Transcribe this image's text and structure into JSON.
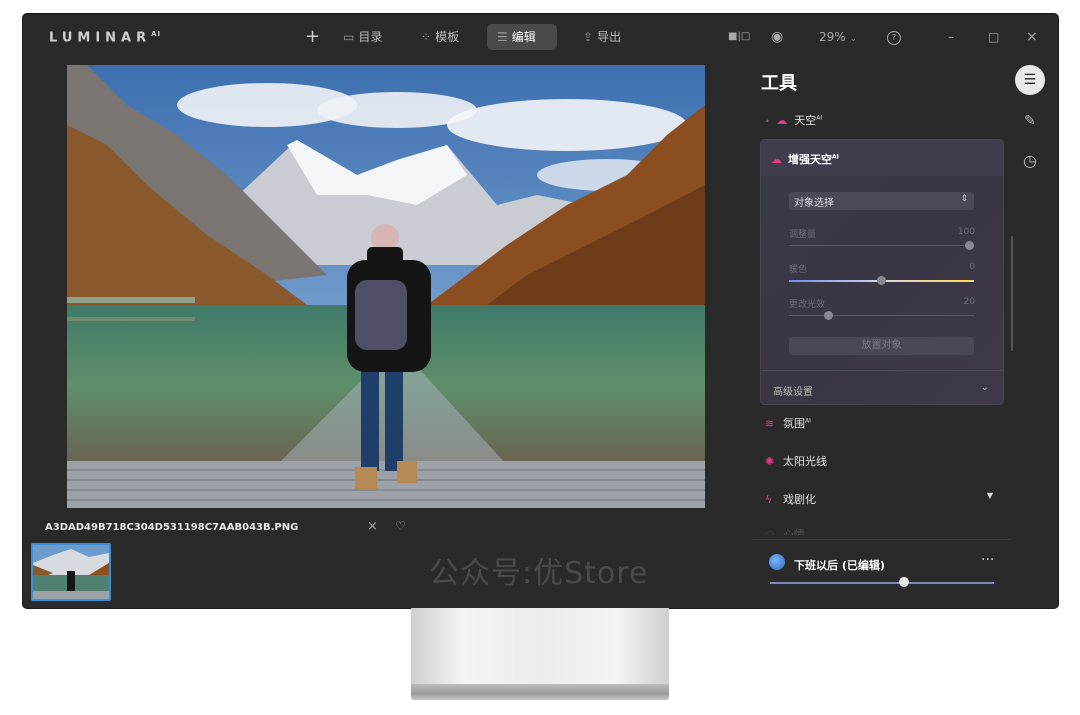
{
  "app": {
    "logo": "LUMINAR",
    "logo_sup": "AI"
  },
  "toolbar": {
    "add_label": "+",
    "catalog_label": "目录",
    "templates_label": "模板",
    "edit_label": "编辑",
    "export_label": "导出",
    "zoom": "29%",
    "help_label": "?"
  },
  "window": {
    "minimize": "–",
    "maximize": "□",
    "close": "×"
  },
  "image": {
    "filename": "A3DAD49B718C304D531198C7AAB043B.PNG",
    "close_label": "×",
    "heart_label": "♡"
  },
  "watermark": "公众号:优Store",
  "panel": {
    "title": "工具",
    "tools": {
      "sky_label": "天空",
      "sky_sup": "AI",
      "sky_enhance_label": "增强天空",
      "sky_enhance_sup": "AI",
      "atmosphere_label": "氛围",
      "atmosphere_sup": "AI",
      "sunrays_label": "太阳光线",
      "dramatic_label": "戏剧化",
      "mood_label": "心情"
    },
    "sky_enhance": {
      "select_value": "对象选择",
      "amount_label": "调整量",
      "amount_value": "100",
      "amount": 100,
      "warmth_label": "暖色",
      "warmth_value": "0",
      "warmth": 0,
      "relight_label": "更改光效",
      "relight_value": "20",
      "relight": 20,
      "place_button": "放置对象",
      "advanced_label": "高级设置"
    }
  },
  "preset": {
    "name": "下班以后 (已编辑)",
    "more_label": "···",
    "amount": 60
  },
  "colors": {
    "accent_pink": "#e63a8c",
    "accent_blue": "#3b8fd9",
    "warmth_gradient_left": "#6f8df0",
    "warmth_gradient_right": "#ffd94a",
    "sunray_orange": "#ff7a3a"
  }
}
